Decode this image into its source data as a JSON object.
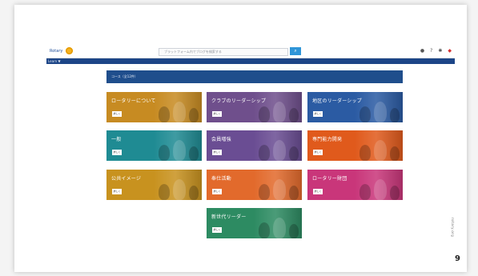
{
  "header": {
    "logo_text": "Rotary",
    "search_placeholder": "ブラットフォーム内でブログを検索する",
    "search_button_icon": "search-icon",
    "icons": [
      "globe-icon",
      "help-icon",
      "settings-icon",
      "notification-icon"
    ]
  },
  "navbar": {
    "label": "Learn ▼"
  },
  "courses": {
    "header_title": "コース（全12件）",
    "tiles": [
      {
        "label": "ロータリーについて",
        "button": "詳しく",
        "color": "#c78b22"
      },
      {
        "label": "クラブのリーダーシップ",
        "button": "詳しく",
        "color": "#6f4f8c"
      },
      {
        "label": "地区のリーダーシップ",
        "button": "詳しく",
        "color": "#2b5ba3"
      },
      {
        "label": "一般",
        "button": "詳しく",
        "color": "#1f8b93"
      },
      {
        "label": "会員増強",
        "button": "詳しく",
        "color": "#6a4d93"
      },
      {
        "label": "専門能力開発",
        "button": "詳しく",
        "color": "#e05a1c"
      },
      {
        "label": "公共イメージ",
        "button": "詳しく",
        "color": "#c8921f"
      },
      {
        "label": "奉仕活動",
        "button": "詳しく",
        "color": "#e26a2c"
      },
      {
        "label": "ロータリー財団",
        "button": "詳しく",
        "color": "#c9367a"
      },
      {
        "label": "新世代リーダー",
        "button": "詳しく",
        "color": "#2d8b62"
      }
    ]
  },
  "slide": {
    "side_text": "rotary.org",
    "page_number": "9"
  }
}
